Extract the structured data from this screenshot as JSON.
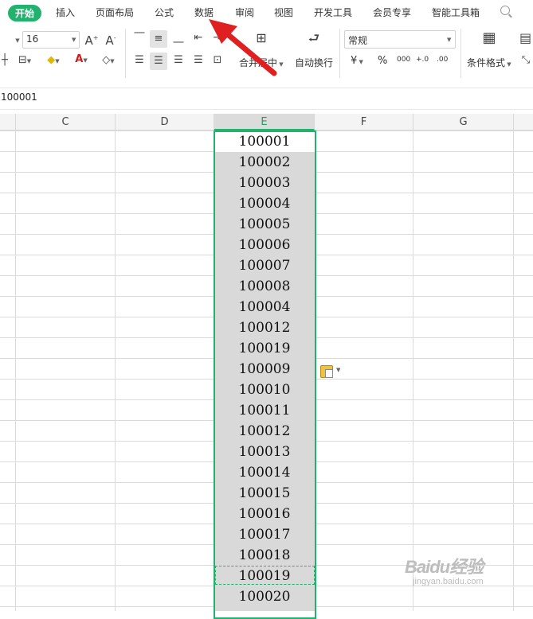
{
  "tabs": [
    {
      "label": "开始",
      "active": true
    },
    {
      "label": "插入"
    },
    {
      "label": "页面布局"
    },
    {
      "label": "公式"
    },
    {
      "label": "数据"
    },
    {
      "label": "审阅"
    },
    {
      "label": "视图"
    },
    {
      "label": "开发工具"
    },
    {
      "label": "会员专享"
    },
    {
      "label": "智能工具箱"
    }
  ],
  "search_label": "Q",
  "ribbon": {
    "font_size": "16",
    "number_format": "常规",
    "merge_center": "合并居中",
    "wrap_text": "自动换行",
    "conditional_format": "条件格式",
    "currency_symbol": "¥",
    "percent_symbol": "%",
    "thousands_symbol": "000",
    "increase_decimal": "+.0",
    "decrease_decimal": ".00"
  },
  "formula_bar": {
    "value": "100001"
  },
  "columns": [
    "C",
    "D",
    "E",
    "F",
    "G"
  ],
  "selected_column": "E",
  "cells_e": [
    "100001",
    "100002",
    "100003",
    "100004",
    "100005",
    "100006",
    "100007",
    "100008",
    "100004",
    "100012",
    "100019",
    "100009",
    "100010",
    "100011",
    "100012",
    "100013",
    "100014",
    "100015",
    "100016",
    "100017",
    "100018",
    "100019",
    "100020"
  ],
  "watermark": {
    "logo": "Baidu经验",
    "url": "jingyan.baidu.com"
  },
  "colors": {
    "accent": "#23b26d",
    "arrow": "#e02020",
    "selection_fill": "#d9d9d9"
  },
  "icons": [
    "font-grow-icon",
    "font-shrink-icon",
    "border-icon",
    "fill-color-icon",
    "font-color-icon",
    "eraser-icon",
    "align-top-icon",
    "align-middle-icon",
    "align-bottom-icon",
    "indent-decrease-icon",
    "indent-increase-icon",
    "align-left-icon",
    "align-center-icon",
    "align-right-icon",
    "justify-icon",
    "distributed-icon",
    "merge-icon",
    "wrap-icon",
    "table-style-icon",
    "paste-options-icon",
    "search-icon",
    "arrow-annotation-icon"
  ]
}
